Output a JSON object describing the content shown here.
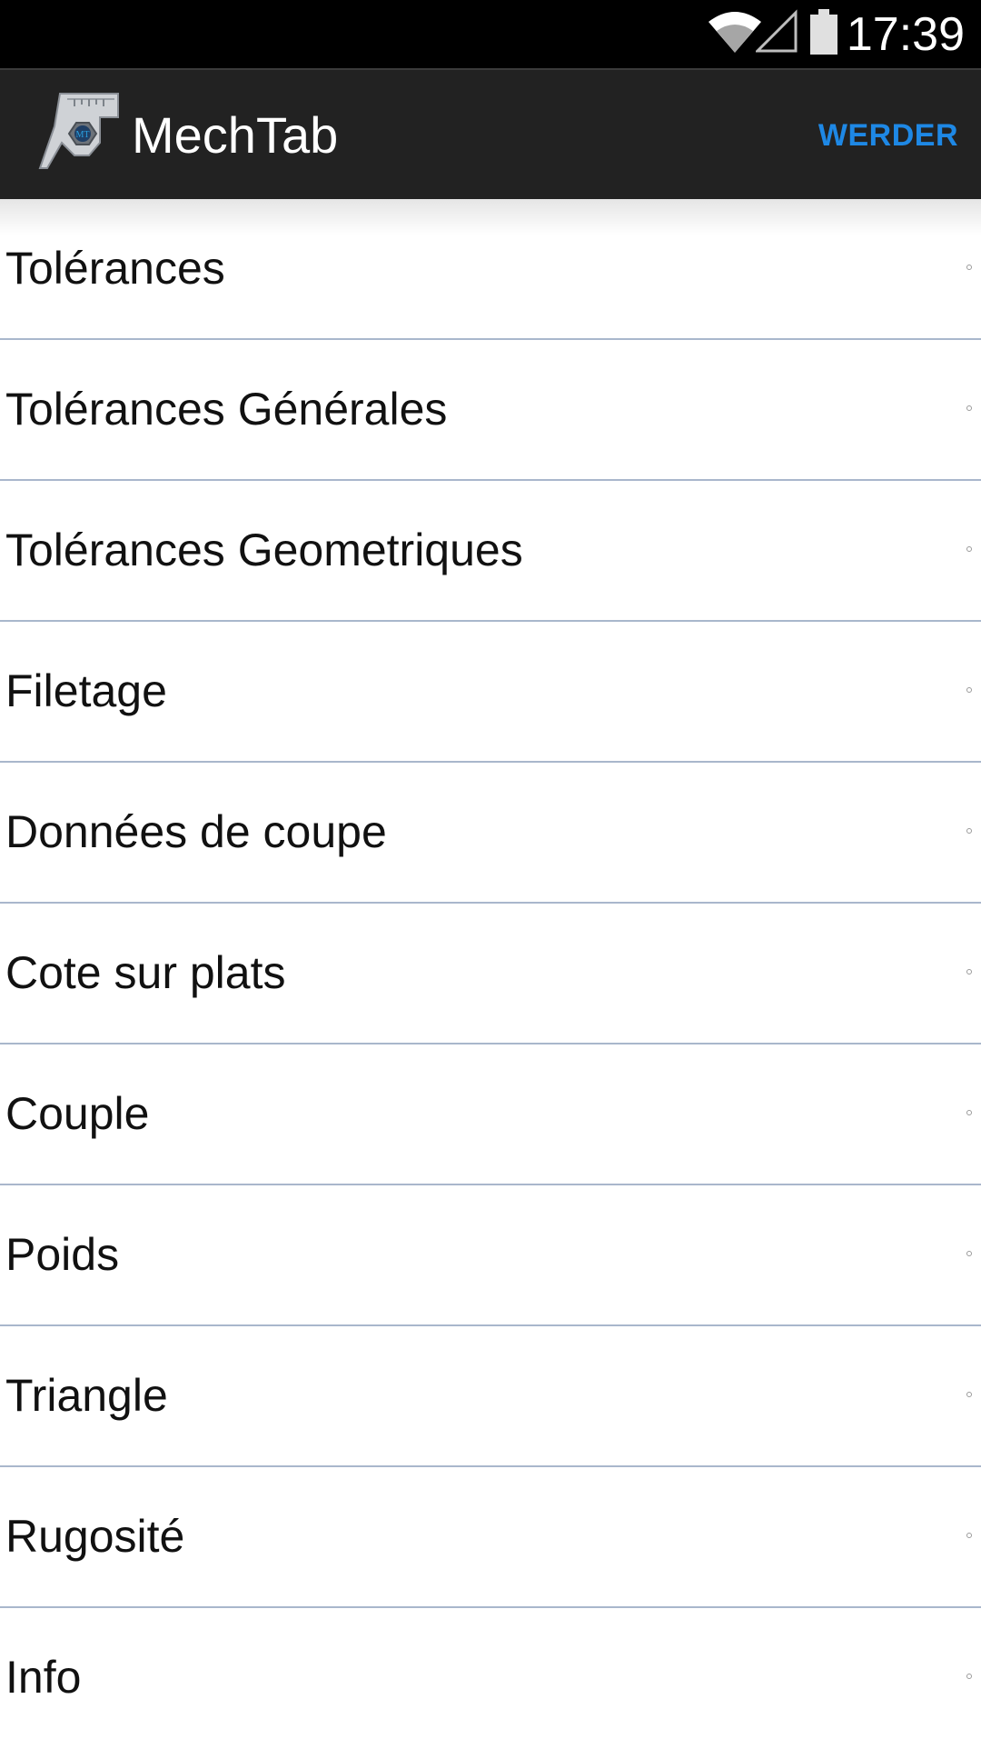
{
  "status_bar": {
    "time": "17:39",
    "icons": [
      "wifi-icon",
      "signal-icon",
      "battery-icon"
    ]
  },
  "action_bar": {
    "title": "MechTab",
    "logo_text": "MT",
    "action_label": "WERDER",
    "accent_color": "#1e88e5",
    "background_color": "#222222"
  },
  "menu": {
    "items": [
      {
        "label": "Tolérances"
      },
      {
        "label": "Tolérances Générales"
      },
      {
        "label": "Tolérances Geometriques"
      },
      {
        "label": "Filetage"
      },
      {
        "label": "Données de coupe"
      },
      {
        "label": "Cote sur plats"
      },
      {
        "label": "Couple"
      },
      {
        "label": "Poids"
      },
      {
        "label": "Triangle"
      },
      {
        "label": "Rugosité"
      },
      {
        "label": "Info"
      }
    ],
    "divider_color": "#a9b7cc"
  }
}
